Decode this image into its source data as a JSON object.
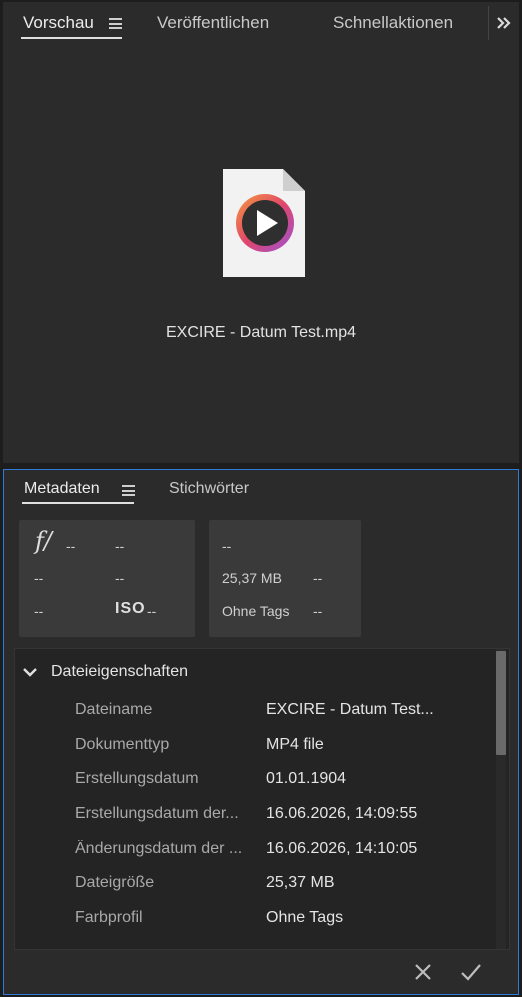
{
  "preview_panel": {
    "tabs": [
      {
        "label": "Vorschau",
        "active": true
      },
      {
        "label": "Veröffentlichen",
        "active": false
      },
      {
        "label": "Schnellaktionen",
        "active": false
      }
    ],
    "file_name": "EXCIRE - Datum Test.mp4",
    "file_icon": "video-file-icon"
  },
  "metadata_panel": {
    "tabs": [
      {
        "label": "Metadaten",
        "active": true
      },
      {
        "label": "Stichwörter",
        "active": false
      }
    ],
    "quick_info": {
      "aperture_icon_label": "f/",
      "aperture": "--",
      "shutter": "--",
      "exposure_comp": "--",
      "focal_length": "--",
      "flash": "--",
      "iso_label": "ISO",
      "iso": "--",
      "dimensions": "--",
      "file_size": "25,37 MB",
      "file_size_extra": "--",
      "color_profile": "Ohne Tags",
      "color_profile_extra": "--"
    },
    "file_properties": {
      "section_title": "Dateieigenschaften",
      "rows": [
        {
          "label": "Dateiname",
          "value": "EXCIRE - Datum Test..."
        },
        {
          "label": "Dokumenttyp",
          "value": "MP4 file"
        },
        {
          "label": "Erstellungsdatum",
          "value": "01.01.1904"
        },
        {
          "label": "Erstellungsdatum der...",
          "value": "16.06.2026, 14:09:55"
        },
        {
          "label": "Änderungsdatum der ...",
          "value": "16.06.2026, 14:10:05"
        },
        {
          "label": "Dateigröße",
          "value": "25,37 MB"
        },
        {
          "label": "Farbprofil",
          "value": "Ohne Tags"
        }
      ]
    }
  },
  "colors": {
    "panel_bg": "#2b2b2b",
    "focus_border": "#2f7cd6",
    "play_ring_gradient": [
      "#f59a3c",
      "#e0466b",
      "#9b52d6"
    ]
  }
}
